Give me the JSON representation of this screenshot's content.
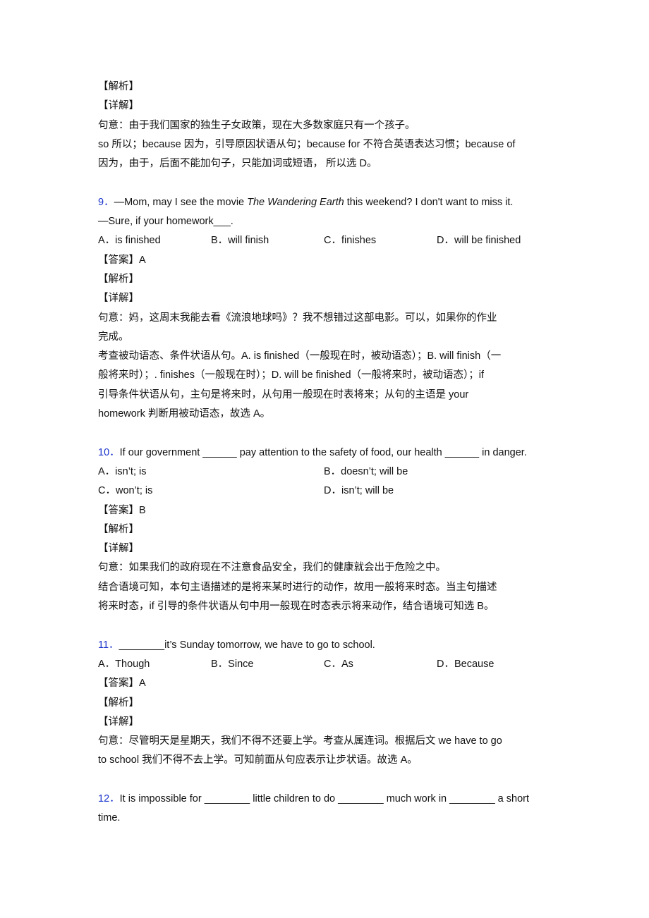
{
  "q8_tail": {
    "analysis_label": "【解析】",
    "detail_label": "【详解】",
    "meaning": "句意：由于我们国家的独生子女政策，现在大多数家庭只有一个孩子。",
    "explain_line1": "so 所以；because 因为，引导原因状语从句；because for 不符合英语表达习惯；because of",
    "explain_line2": "因为，由于，后面不能加句子，只能加词或短语， 所以选 D。"
  },
  "q9": {
    "number": "9．",
    "stem_pre": "—Mom, may I see the movie ",
    "stem_italic": "The Wandering Earth",
    "stem_post": " this weekend? I don't want to miss it.",
    "stem_line2": "—Sure, if your homework___.",
    "options": [
      "A．is finished",
      "B．will finish",
      "C．finishes",
      "D．will be finished"
    ],
    "answer": "【答案】A",
    "analysis_label": "【解析】",
    "detail_label": "【详解】",
    "explanation": [
      "句意：妈，这周末我能去看《流浪地球吗》？我不想错过这部电影。可以，如果你的作业",
      "完成。",
      "考查被动语态、条件状语从句。A. is finished（一般现在时，被动语态）；B. will finish（一",
      "般将来时）；. finishes（一般现在时）；D. will be finished（一般将来时，被动语态）；if",
      "引导条件状语从句，主句是将来时，从句用一般现在时表将来；从句的主语是 your",
      "homework 判断用被动语态，故选 A。"
    ]
  },
  "q10": {
    "number": "10．",
    "stem": "If our government ______ pay attention to the safety of food, our health ______ in danger.",
    "options": [
      "A．isn’t; is",
      "B．doesn’t; will be",
      "C．won’t; is",
      "D．isn’t; will be"
    ],
    "answer": "【答案】B",
    "analysis_label": "【解析】",
    "detail_label": "【详解】",
    "explanation": [
      "句意：如果我们的政府现在不注意食品安全，我们的健康就会出于危险之中。",
      "结合语境可知，本句主语描述的是将来某时进行的动作，故用一般将来时态。当主句描述",
      "将来时态，if 引导的条件状语从句中用一般现在时态表示将来动作，结合语境可知选 B。"
    ]
  },
  "q11": {
    "number": "11．",
    "stem": "________it’s Sunday tomorrow, we have to go to school.",
    "options": [
      "A．Though",
      "B．Since",
      "C．As",
      "D．Because"
    ],
    "answer": "【答案】A",
    "analysis_label": "【解析】",
    "detail_label": "【详解】",
    "explanation": [
      "句意：尽管明天是星期天，我们不得不还要上学。考查从属连词。根据后文 we have to go",
      "to school 我们不得不去上学。可知前面从句应表示让步状语。故选 A。"
    ]
  },
  "q12": {
    "number": "12．",
    "stem_line1": "It is impossible for ________ little children to do ________ much work in ________ a short",
    "stem_line2": "time."
  }
}
